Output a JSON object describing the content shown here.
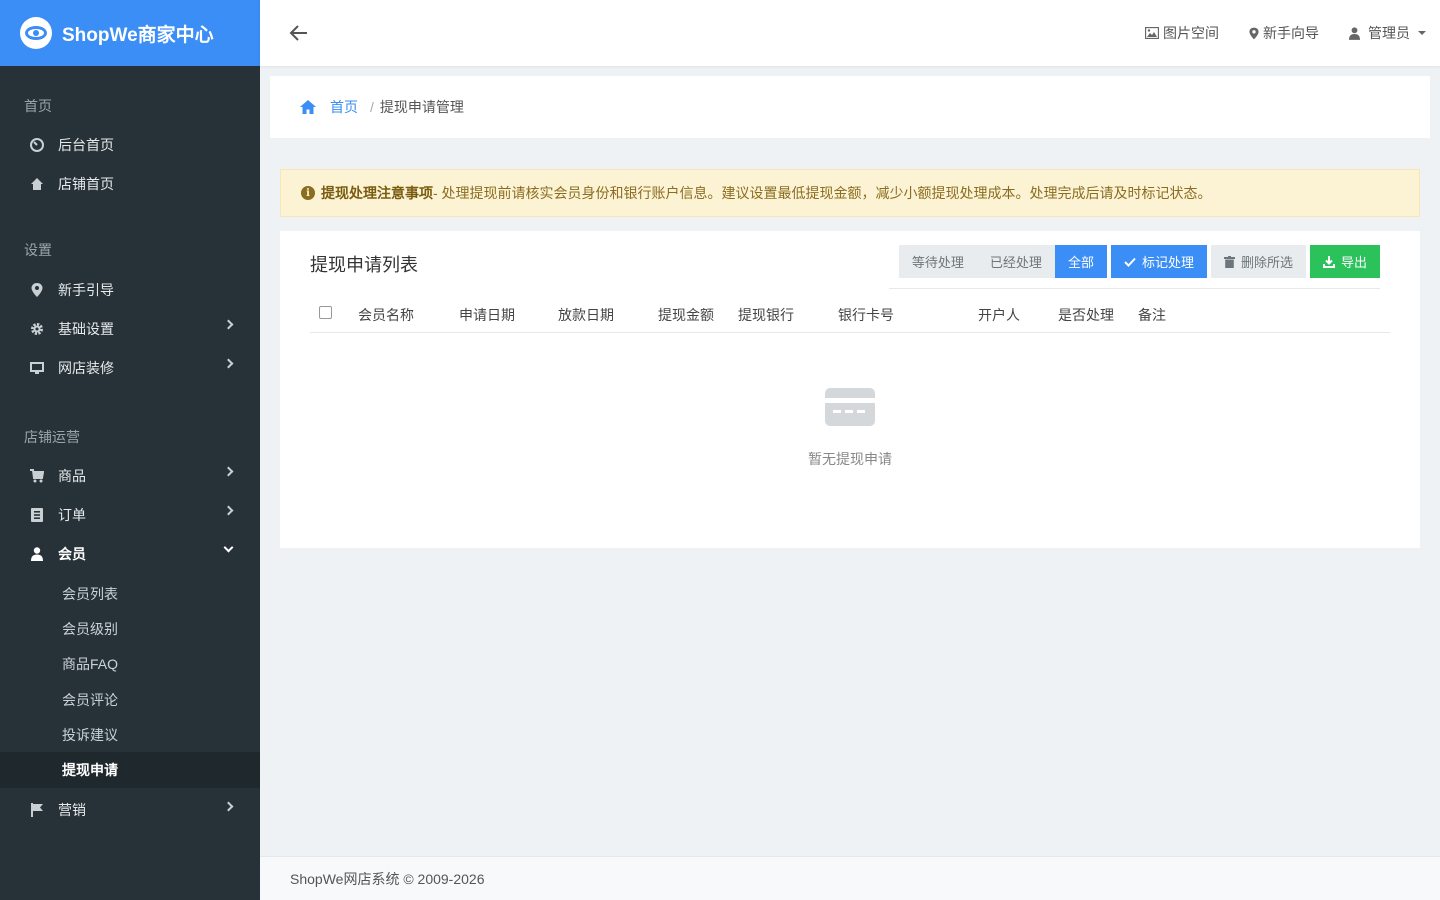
{
  "brand": {
    "name": "ShopWe商家中心"
  },
  "sidebar": {
    "sections": [
      {
        "label": "首页"
      },
      {
        "label": "设置"
      },
      {
        "label": "店铺运营"
      }
    ],
    "home_items": [
      {
        "label": "后台首页",
        "icon": "dashboard-icon"
      },
      {
        "label": "店铺首页",
        "icon": "home-icon"
      }
    ],
    "settings_items": [
      {
        "label": "新手引导",
        "icon": "map-marker-icon"
      },
      {
        "label": "基础设置",
        "icon": "gear-icon"
      },
      {
        "label": "网店装修",
        "icon": "monitor-icon"
      }
    ],
    "ops_items": [
      {
        "label": "商品",
        "icon": "cart-icon"
      },
      {
        "label": "订单",
        "icon": "list-icon"
      },
      {
        "label": "会员",
        "icon": "user-icon"
      },
      {
        "label": "营销",
        "icon": "flag-icon"
      }
    ],
    "member_sub": [
      {
        "label": "会员列表"
      },
      {
        "label": "会员级别"
      },
      {
        "label": "商品FAQ"
      },
      {
        "label": "会员评论"
      },
      {
        "label": "投诉建议"
      },
      {
        "label": "提现申请"
      }
    ]
  },
  "header": {
    "links": [
      {
        "label": "图片空间",
        "icon": "image-icon"
      },
      {
        "label": "新手向导",
        "icon": "map-marker-icon"
      },
      {
        "label": "管理员",
        "icon": "user-icon"
      }
    ]
  },
  "breadcrumb": {
    "home": "首页",
    "separator": "/",
    "current": "提现申请管理"
  },
  "alert": {
    "title": "提现处理注意事项",
    "text": " - 处理提现前请核实会员身份和银行账户信息。建议设置最低提现金额，减少小额提现处理成本。处理完成后请及时标记状态。"
  },
  "card": {
    "title": "提现申请列表",
    "buttons": {
      "pending": "等待处理",
      "processed": "已经处理",
      "all": "全部",
      "mark": "标记处理",
      "delete": "删除所选",
      "export": "导出"
    },
    "columns": [
      "会员名称",
      "申请日期",
      "放款日期",
      "提现金额",
      "提现银行",
      "银行卡号",
      "开户人",
      "是否处理",
      "备注"
    ],
    "empty_text": "暂无提现申请"
  },
  "footer": {
    "text": "ShopWe网店系统 © 2009-2026"
  },
  "colors": {
    "brand": "#3a8ef6",
    "sidebar": "#263238",
    "success": "#2bc25c",
    "alert_bg": "#fcf3d4"
  }
}
